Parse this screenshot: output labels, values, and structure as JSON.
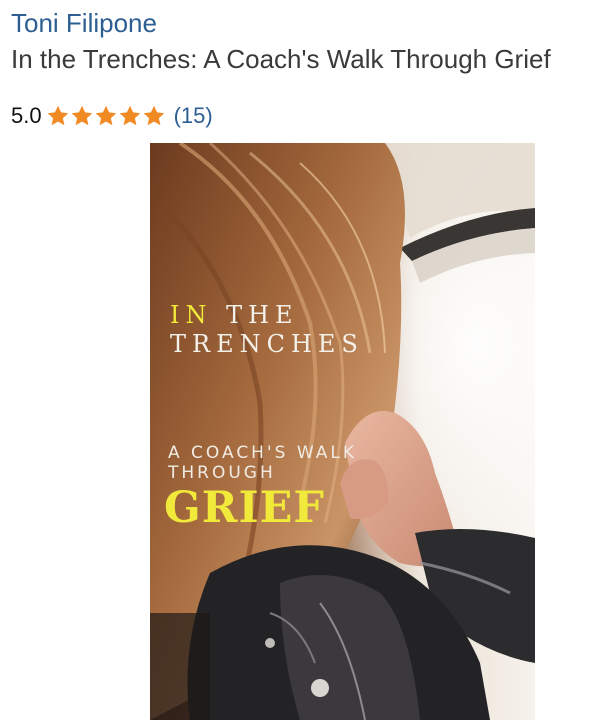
{
  "product": {
    "author": "Toni Filipone",
    "title": "In the Trenches: A Coach's Walk Through Grief",
    "rating_value": "5.0",
    "rating_stars": 5,
    "review_count": "(15)"
  },
  "cover": {
    "line1_part1": "IN",
    "line1_part2": " THE",
    "line2": "TRENCHES",
    "line3": "A COACH'S WALK",
    "line4": "THROUGH",
    "line5": "GRIEF"
  },
  "colors": {
    "author_link": "#2e5f93",
    "title_text": "#3a3a3a",
    "star_fill": "#f08a24",
    "cover_accent": "#f2ea3a"
  },
  "icons": {
    "star": "star-icon"
  }
}
